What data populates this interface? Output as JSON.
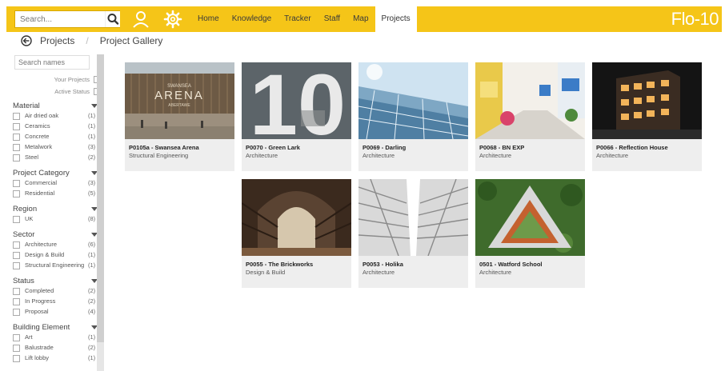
{
  "search": {
    "placeholder": "Search..."
  },
  "nav": {
    "tabs": [
      {
        "label": "Home"
      },
      {
        "label": "Knowledge"
      },
      {
        "label": "Tracker"
      },
      {
        "label": "Staff"
      },
      {
        "label": "Map"
      },
      {
        "label": "Projects",
        "active": true
      }
    ]
  },
  "logo": {
    "text": "Flo-10"
  },
  "breadcrumb": {
    "section": "Projects",
    "page": "Project Gallery"
  },
  "sidebar": {
    "search_placeholder": "Search names",
    "your_projects": "Your Projects",
    "active_status": "Active Status",
    "groups": [
      {
        "title": "Material",
        "items": [
          {
            "label": "Air dried oak",
            "count": "(1)"
          },
          {
            "label": "Ceramics",
            "count": "(1)"
          },
          {
            "label": "Concrete",
            "count": "(1)"
          },
          {
            "label": "Metalwork",
            "count": "(3)"
          },
          {
            "label": "Steel",
            "count": "(2)"
          }
        ]
      },
      {
        "title": "Project Category",
        "items": [
          {
            "label": "Commercial",
            "count": "(3)"
          },
          {
            "label": "Residential",
            "count": "(5)"
          }
        ]
      },
      {
        "title": "Region",
        "items": [
          {
            "label": "UK",
            "count": "(8)"
          }
        ]
      },
      {
        "title": "Sector",
        "items": [
          {
            "label": "Architecture",
            "count": "(6)"
          },
          {
            "label": "Design & Build",
            "count": "(1)"
          },
          {
            "label": "Structural Engineering",
            "count": "(1)"
          }
        ]
      },
      {
        "title": "Status",
        "items": [
          {
            "label": "Completed",
            "count": "(2)"
          },
          {
            "label": "In Progress",
            "count": "(2)"
          },
          {
            "label": "Proposal",
            "count": "(4)"
          }
        ]
      },
      {
        "title": "Building Element",
        "items": [
          {
            "label": "Art",
            "count": "(1)"
          },
          {
            "label": "Balustrade",
            "count": "(2)"
          },
          {
            "label": "Lift lobby",
            "count": "(1)"
          }
        ]
      }
    ]
  },
  "projects": [
    {
      "title": "P0105a - Swansea Arena",
      "sector": "Structural Engineering",
      "image_text": "SWANSEA",
      "image_text2": "ARENA",
      "image_text3": "ABERTAWE"
    },
    {
      "title": "P0070 - Green Lark",
      "sector": "Architecture",
      "image_text": "10"
    },
    {
      "title": "P0069 - Darling",
      "sector": "Architecture"
    },
    {
      "title": "P0068 - BN EXP",
      "sector": "Architecture"
    },
    {
      "title": "P0066 - Reflection House",
      "sector": "Architecture"
    },
    {
      "title": "P0055 - The Brickworks",
      "sector": "Design & Build"
    },
    {
      "title": "P0053 - Holika",
      "sector": "Architecture"
    },
    {
      "title": "0501 - Watford School",
      "sector": "Architecture"
    }
  ],
  "colors": {
    "brand": "#f5c518",
    "card_bg": "#eeeeee"
  }
}
